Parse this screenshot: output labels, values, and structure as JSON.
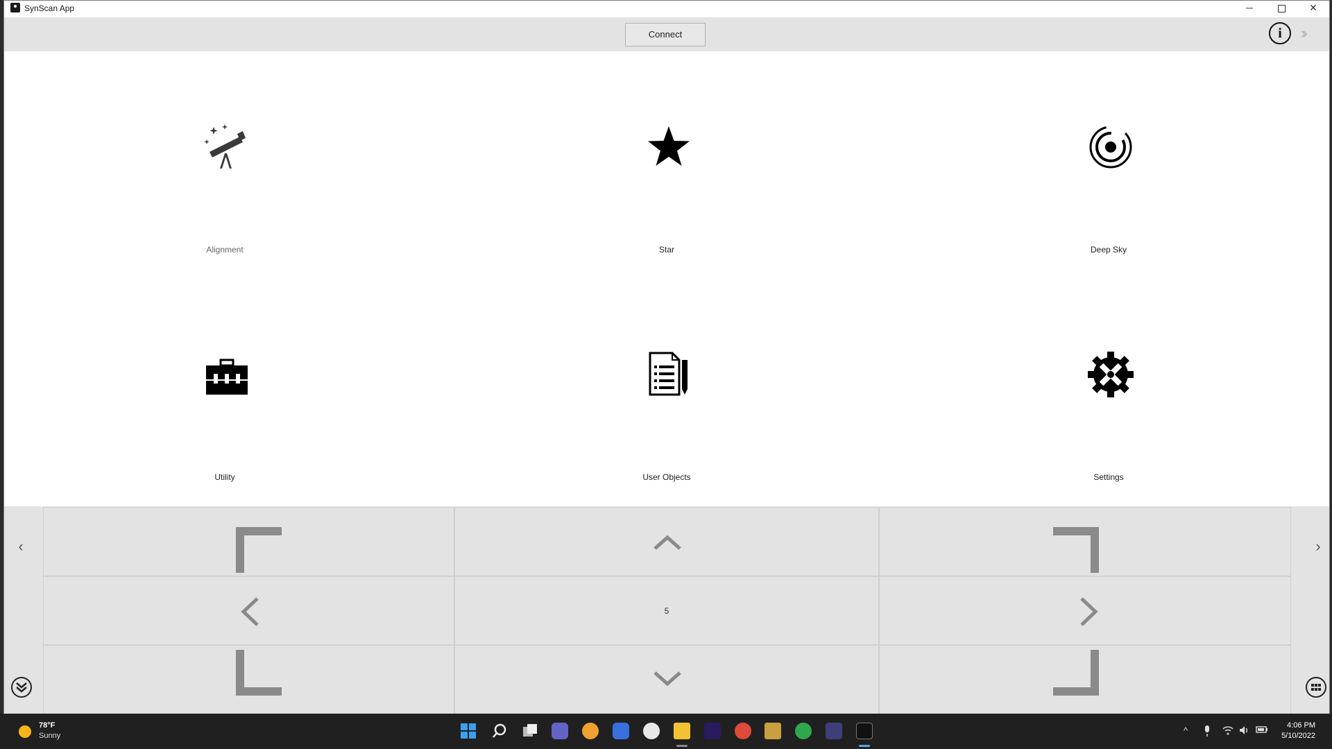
{
  "window": {
    "title": "SynScan App",
    "minimize_glyph": "─",
    "close_glyph": "✕"
  },
  "toolbar": {
    "connect_label": "Connect",
    "info_glyph": "i",
    "forward_glyph": "›››"
  },
  "tiles": [
    {
      "label": "Alignment",
      "icon": "telescope-icon"
    },
    {
      "label": "Star",
      "icon": "star-icon"
    },
    {
      "label": "Deep Sky",
      "icon": "galaxy-spiral-icon"
    },
    {
      "label": "Utility",
      "icon": "toolbox-icon"
    },
    {
      "label": "User Objects",
      "icon": "document-pen-icon"
    },
    {
      "label": "Settings",
      "icon": "gear-icon"
    }
  ],
  "pad": {
    "speed": "5",
    "left_page_glyph": "‹",
    "right_page_glyph": "›"
  },
  "taskbar": {
    "weather_temp": "78°F",
    "weather_condition": "Sunny",
    "time": "4:06 PM",
    "date": "5/10/2022",
    "tray_chevron": "^"
  },
  "colors": {
    "toolbar_bg": "#e3e3e3",
    "pad_bg": "#e3e3e3",
    "pad_arrow": "#8a8a8a",
    "taskbar_bg": "#202020"
  }
}
